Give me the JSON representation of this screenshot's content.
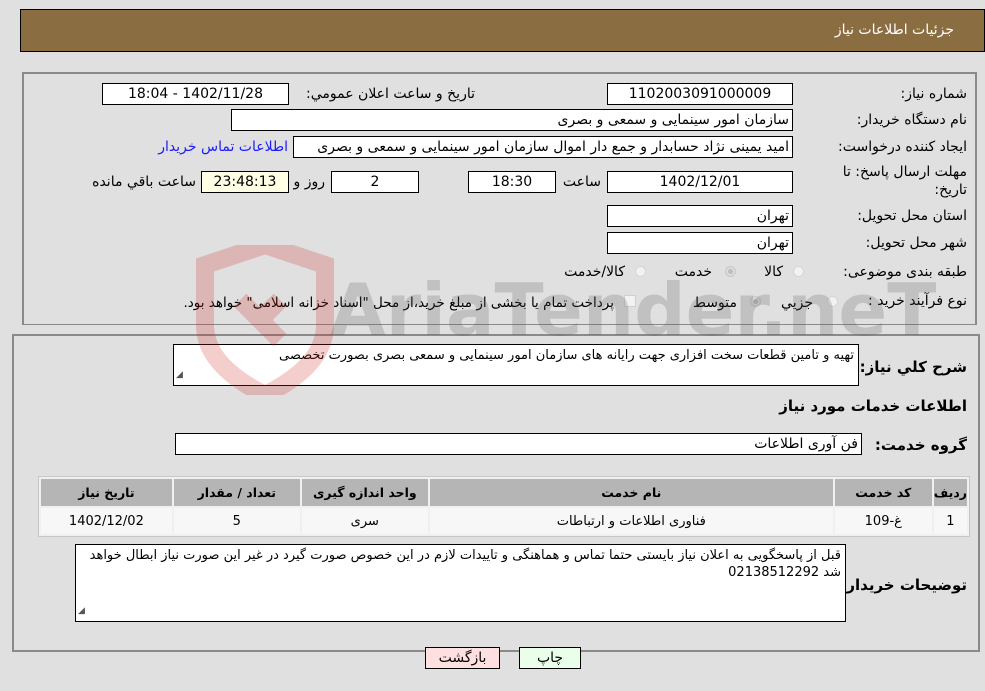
{
  "header": {
    "title": "جزئیات اطلاعات نیاز"
  },
  "form": {
    "need_number": {
      "label": "شماره نیاز:",
      "value": "1102003091000009"
    },
    "announce_datetime": {
      "label": "تاریخ و ساعت اعلان عمومي:",
      "value": "1402/11/28 - 18:04"
    },
    "buyer_org": {
      "label": "نام دستگاه خريدار:",
      "value": "سازمان امور سینمایی و سمعی و بصری"
    },
    "requester": {
      "label": "ایجاد کننده درخواست:",
      "value": "امید یمینی نژاد حسابدار و جمع دار اموال سازمان امور سینمایی و سمعی و بصری",
      "contact_link": "اطلاعات تماس خریدار"
    },
    "deadline": {
      "label_line1": "مهلت ارسال پاسخ: تا",
      "label_line2": "تاریخ:",
      "date": "1402/12/01",
      "time_label": "ساعت",
      "time": "18:30",
      "days": "2",
      "days_label": "روز و",
      "remaining": "23:48:13",
      "remaining_label": "ساعت باقي مانده"
    },
    "province": {
      "label": "استان محل تحویل:",
      "value": "تهران"
    },
    "city": {
      "label": "شهر محل تحویل:",
      "value": "تهران"
    },
    "category": {
      "label": "طبقه بندی موضوعی:",
      "options": [
        {
          "label": "کالا",
          "selected": false
        },
        {
          "label": "خدمت",
          "selected": true
        },
        {
          "label": "کالا/خدمت",
          "selected": false
        }
      ]
    },
    "purchase_type": {
      "label": "نوع فرآیند خرید :",
      "options": [
        {
          "label": "جزيي",
          "selected": false
        },
        {
          "label": "متوسط",
          "selected": true
        }
      ],
      "treasury_checkbox_label": "پرداخت تمام یا بخشی از مبلغ خرید،از محل \"اسناد خزانه اسلامی\" خواهد بود.",
      "treasury_checked": false
    }
  },
  "details": {
    "general_desc": {
      "label": "شرح كلي نياز:",
      "value": "تهیه و تامین قطعات سخت افزاری جهت رایانه های سازمان امور سینمایی و سمعی بصری بصورت تخصصی"
    },
    "services_heading": "اطلاعات خدمات مورد نیاز",
    "service_group": {
      "label": "گروه خدمت:",
      "value": "فن آوری اطلاعات"
    },
    "table": {
      "columns": [
        "ردیف",
        "کد خدمت",
        "نام خدمت",
        "واحد اندازه گیری",
        "تعداد / مقدار",
        "تاریخ نیاز"
      ],
      "rows": [
        [
          "1",
          "غ-109",
          "فناوری اطلاعات و ارتباطات",
          "سری",
          "5",
          "1402/12/02"
        ]
      ]
    },
    "buyer_notes": {
      "label": "توضیحات خریدار:",
      "value": "قبل از پاسخگویی به اعلان نیاز بایستی حتما تماس و هماهنگی و تاییدات لازم در این خصوص صورت گیرد در غیر این صورت نیاز ابطال خواهد شد 02138512292"
    }
  },
  "buttons": {
    "print": "چاپ",
    "back": "بازگشت"
  },
  "watermark": {
    "text": "AriaTender.neT"
  }
}
